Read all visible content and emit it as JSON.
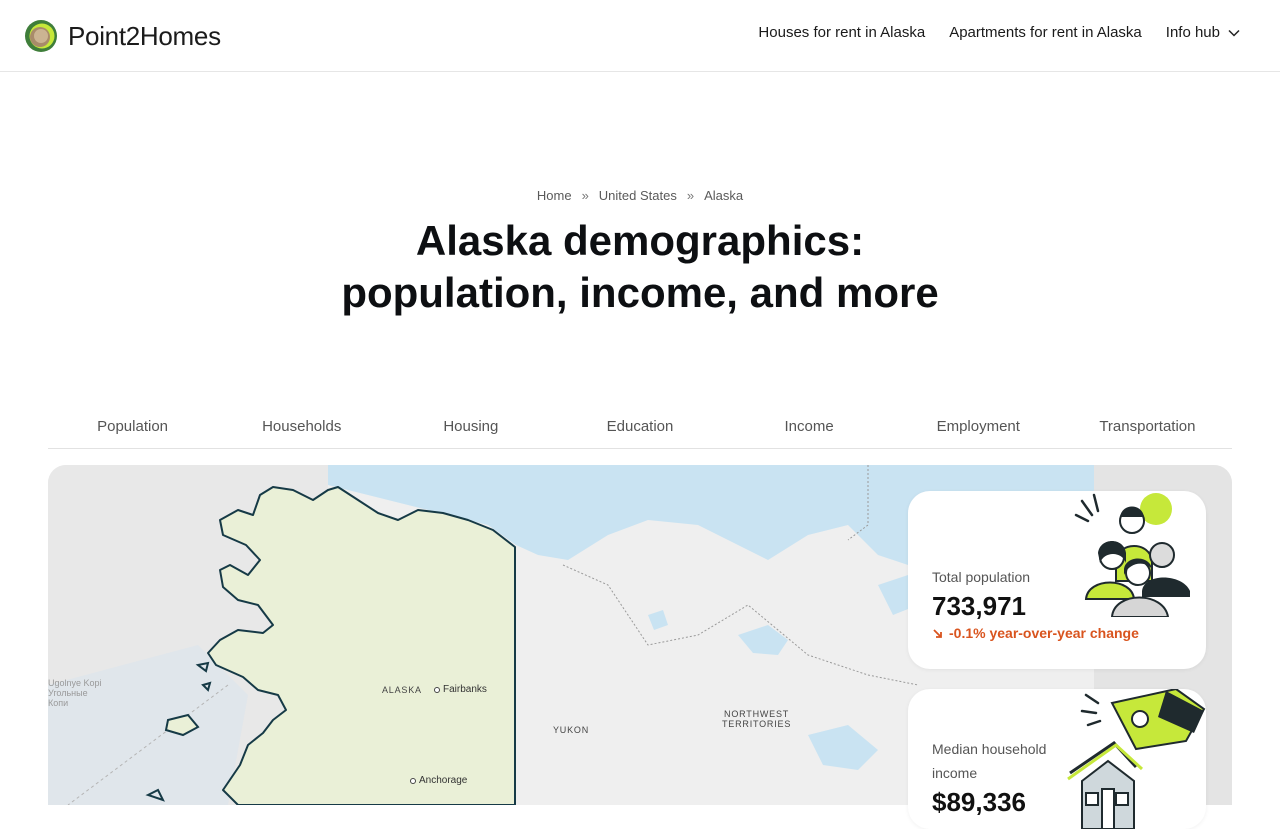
{
  "brand": {
    "name": "Point2Homes"
  },
  "nav": {
    "houses": "Houses for rent in Alaska",
    "apartments": "Apartments for rent in Alaska",
    "info_hub": "Info hub"
  },
  "breadcrumb": {
    "home": "Home",
    "sep": "»",
    "country": "United States",
    "state": "Alaska"
  },
  "hero": {
    "title_line1": "Alaska demographics:",
    "title_line2": "population, income, and more"
  },
  "tabs": [
    "Population",
    "Households",
    "Housing",
    "Education",
    "Income",
    "Employment",
    "Transportation"
  ],
  "map": {
    "state_label": "ALASKA",
    "yukon_label": "YUKON",
    "nwt_label_1": "NORTHWEST",
    "nwt_label_2": "TERRITORIES",
    "cities": {
      "fairbanks": "Fairbanks",
      "anchorage": "Anchorage"
    },
    "faint": {
      "line1": "Ugolnye Kopi",
      "line2": "Угольные",
      "line3": "Копи"
    }
  },
  "stats": {
    "population": {
      "label": "Total population",
      "value": "733,971",
      "change": "-0.1% year-over-year change",
      "change_icon": "arrow-down-right-icon"
    },
    "income": {
      "label_1": "Median household",
      "label_2": "income",
      "value": "$89,336"
    }
  },
  "colors": {
    "accent_green": "#c6e83a",
    "change_orange": "#d9541e",
    "map_water": "#c9e3f2",
    "alaska_fill": "#eaf0d7",
    "alaska_border": "#163a46"
  }
}
